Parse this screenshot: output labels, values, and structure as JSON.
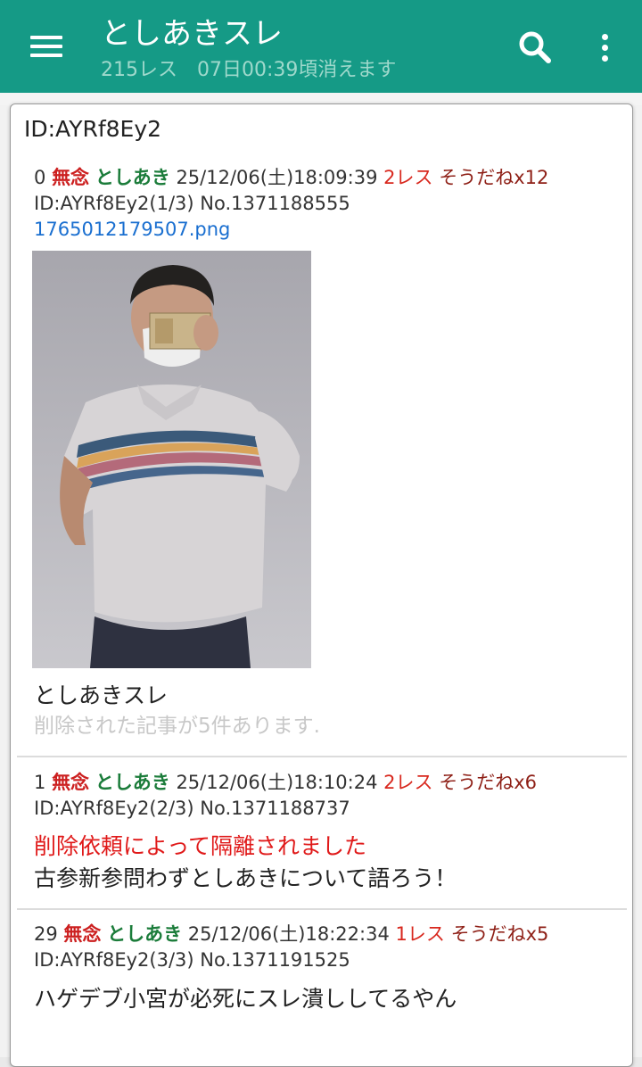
{
  "appbar": {
    "title": "としあきスレ",
    "subtitle": "215レス　07日00:39頃消えます"
  },
  "popup": {
    "title": "ID:AYRf8Ey2",
    "posts": [
      {
        "number": "0",
        "status": "無念",
        "name": "としあき",
        "datetime": "25/12/06(土)18:09:39",
        "replies": "2レス",
        "soudane": "そうだねx12",
        "id_line": "ID:AYRf8Ey2(1/3) No.1371188555",
        "file": "1765012179507.png",
        "body": "としあきスレ",
        "deleted_note": "削除された記事が5件あります."
      },
      {
        "number": "1",
        "status": "無念",
        "name": "としあき",
        "datetime": "25/12/06(土)18:10:24",
        "replies": "2レス",
        "soudane": "そうだねx6",
        "id_line": "ID:AYRf8Ey2(2/3) No.1371188737",
        "notice": "削除依頼によって隔離されました",
        "body": "古参新参問わずとしあきについて語ろう！"
      },
      {
        "number": "29",
        "status": "無念",
        "name": "としあき",
        "datetime": "25/12/06(土)18:22:34",
        "replies": "1レス",
        "soudane": "そうだねx5",
        "id_line": "ID:AYRf8Ey2(3/3) No.1371191525",
        "body": "ハゲデブ小宮が必死にスレ潰ししてるやん"
      }
    ]
  },
  "colors": {
    "appbar": "#159a86",
    "status": "#cc1f1f",
    "name": "#1b7c3a",
    "replies": "#d8281e",
    "soudane": "#8e1f16",
    "link": "#1a6fd0",
    "notice": "#e01919"
  },
  "icons": [
    "menu-icon",
    "search-icon",
    "more-vert-icon"
  ]
}
